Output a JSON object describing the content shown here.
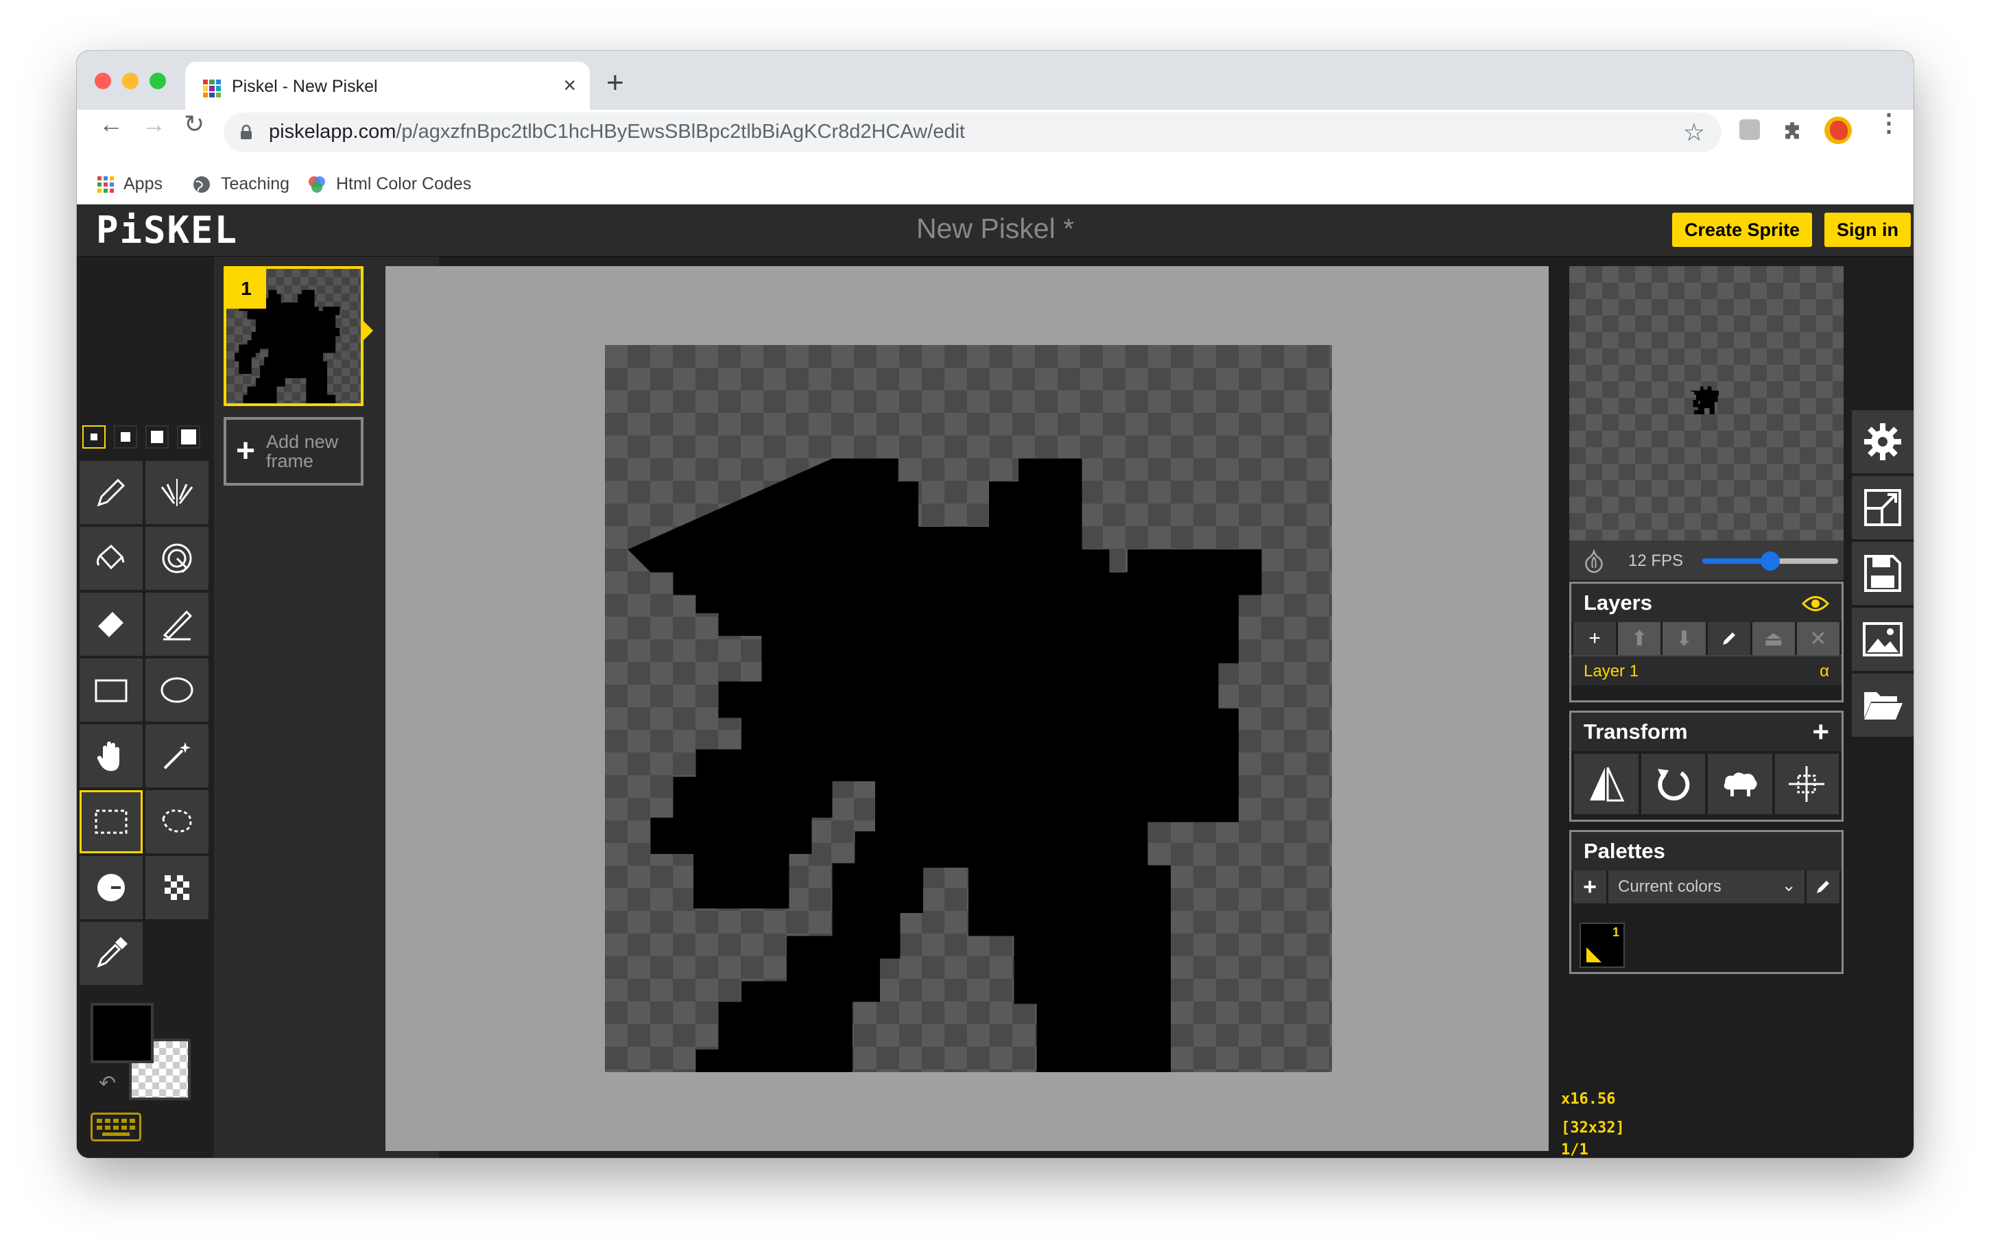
{
  "browser": {
    "tab_title": "Piskel - New Piskel",
    "url_host": "piskelapp.com",
    "url_path": "/p/agxzfnBpc2tlbC1hcHByEwsSBlBpc2tlbBiAgKCr8d2HCAw/edit",
    "bookmarks": [
      {
        "label": "Apps",
        "icon": "apps-grid-icon"
      },
      {
        "label": "Teaching",
        "icon": "globe-icon"
      },
      {
        "label": "Html Color Codes",
        "icon": "color-wheel-icon"
      }
    ]
  },
  "app": {
    "logo": "PiSKEL",
    "document_title": "New Piskel *",
    "create_sprite_label": "Create Sprite",
    "sign_in_label": "Sign in"
  },
  "tools": {
    "pen_sizes": [
      1,
      2,
      3,
      4
    ],
    "selected_pen_size": 1,
    "items": [
      "pen-tool",
      "vertical-mirror-pen-tool",
      "paint-bucket-tool",
      "paint-all-same-color-tool",
      "eraser-tool",
      "stroke-tool",
      "rectangle-tool",
      "circle-tool",
      "move-tool",
      "shape-selection-tool",
      "rectangle-selection-tool",
      "lasso-selection-tool",
      "lighten-tool",
      "dithering-tool",
      "color-picker-tool"
    ],
    "selected_tool": "rectangle-selection-tool",
    "primary_color": "#000000",
    "secondary_color": "transparent"
  },
  "frames": {
    "items": [
      {
        "number": "1"
      }
    ],
    "add_frame_label_line1": "Add new",
    "add_frame_label_line2": "frame"
  },
  "preview": {
    "fps_label": "12 FPS",
    "fps_value": 12,
    "fps_fraction": 0.5
  },
  "layers": {
    "title": "Layers",
    "items": [
      {
        "name": "Layer 1",
        "opacity_symbol": "α"
      }
    ]
  },
  "transform": {
    "title": "Transform"
  },
  "palettes": {
    "title": "Palettes",
    "selected": "Current colors",
    "swatches": [
      {
        "index": "1",
        "color": "#000000"
      }
    ]
  },
  "status": {
    "zoom": "x16.56",
    "size": "[32x32]",
    "frame_index": "1/1"
  },
  "colors": {
    "accent": "#ffd700",
    "panel": "#3a3a3a",
    "canvas_stage": "#a0a0a0"
  }
}
